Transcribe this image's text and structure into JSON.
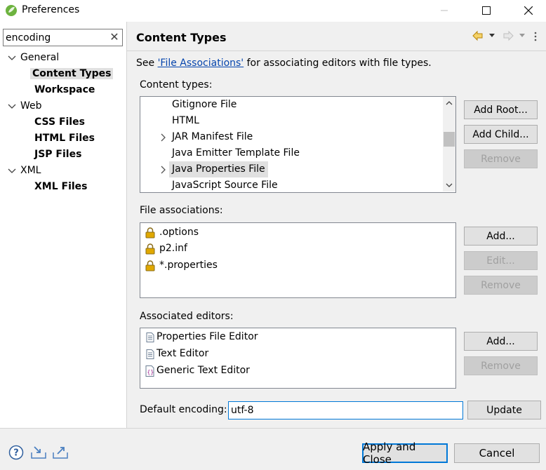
{
  "window": {
    "title": "Preferences"
  },
  "filter": {
    "value": "encoding",
    "clear_glyph": "✕"
  },
  "tree": [
    {
      "label": "General",
      "expanded": true
    },
    {
      "label": "Content Types",
      "selected": true
    },
    {
      "label": "Workspace"
    },
    {
      "label": "Web",
      "expanded": true
    },
    {
      "label": "CSS Files"
    },
    {
      "label": "HTML Files"
    },
    {
      "label": "JSP Files"
    },
    {
      "label": "XML",
      "expanded": true
    },
    {
      "label": "XML Files"
    }
  ],
  "page": {
    "title": "Content Types",
    "see_prefix": "See ",
    "see_link": "'File Associations'",
    "see_suffix": " for associating editors with file types."
  },
  "content_types": {
    "label": "Content types:",
    "items": [
      {
        "label": "Gitignore File",
        "expandable": false
      },
      {
        "label": "HTML",
        "expandable": false
      },
      {
        "label": "JAR Manifest File",
        "expandable": true
      },
      {
        "label": "Java Emitter Template File",
        "expandable": false
      },
      {
        "label": "Java Properties File",
        "expandable": true,
        "selected": true
      },
      {
        "label": "JavaScript Source File",
        "expandable": false
      }
    ],
    "buttons": {
      "add_root": "Add Root...",
      "add_child": "Add Child...",
      "remove": "Remove"
    }
  },
  "file_associations": {
    "label": "File associations:",
    "items": [
      ".options",
      "p2.inf",
      "*.properties"
    ],
    "buttons": {
      "add": "Add...",
      "edit": "Edit...",
      "remove": "Remove"
    }
  },
  "associated_editors": {
    "label": "Associated editors:",
    "items": [
      {
        "label": "Properties File Editor",
        "icon": "document-icon"
      },
      {
        "label": "Text Editor",
        "icon": "document-icon"
      },
      {
        "label": "Generic Text Editor",
        "icon": "generic-editor-icon"
      }
    ],
    "buttons": {
      "add": "Add...",
      "remove": "Remove"
    }
  },
  "default_encoding": {
    "label": "Default encoding:",
    "value": "utf-8",
    "update": "Update"
  },
  "footer": {
    "apply_close": "Apply and Close",
    "cancel": "Cancel"
  },
  "colors": {
    "accent": "#0078d7",
    "link": "#0645ad",
    "lock": "#e0a800",
    "eclipse_green": "#6db33f"
  }
}
